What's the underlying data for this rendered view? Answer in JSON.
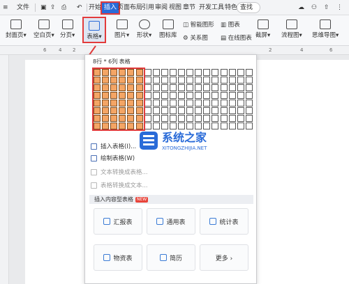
{
  "menu": {
    "file": "文件",
    "tabs": [
      "开始",
      "插入",
      "页面布局",
      "引用",
      "审阅",
      "视图",
      "章节",
      "开发工具",
      "特色功能"
    ],
    "search": "查找"
  },
  "ribbon": {
    "cover": "封面页",
    "blank": "空白页",
    "break": "分页",
    "table": "表格",
    "picture": "图片",
    "shape": "形状",
    "icons": "图标库",
    "smartart": "智能图形",
    "relation": "关系图",
    "chart": "图表",
    "online_chart": "在线图表",
    "screenshot": "截屏",
    "flow": "流程图",
    "mind": "思维导图"
  },
  "ruler": [
    "6",
    "4",
    "2",
    "2",
    "4",
    "6"
  ],
  "popup": {
    "grid_label": "8行 * 6列 表格",
    "grid": {
      "cols": 19,
      "rows": 8,
      "selected_cols": 6,
      "selected_rows": 8
    },
    "watermark_cn": "系统之家",
    "watermark_en": "XITONGZHIJIA.NET",
    "items": [
      {
        "label": "插入表格(I)...",
        "enabled": true
      },
      {
        "label": "绘制表格(W)",
        "enabled": true
      },
      {
        "label": "文本转换成表格...",
        "enabled": false
      },
      {
        "label": "表格转换成文本...",
        "enabled": false
      }
    ],
    "section": "插入内容型表格",
    "badge": "NEW",
    "cards": [
      "汇报表",
      "通用表",
      "统计表",
      "物资表",
      "简历",
      "更多"
    ]
  }
}
